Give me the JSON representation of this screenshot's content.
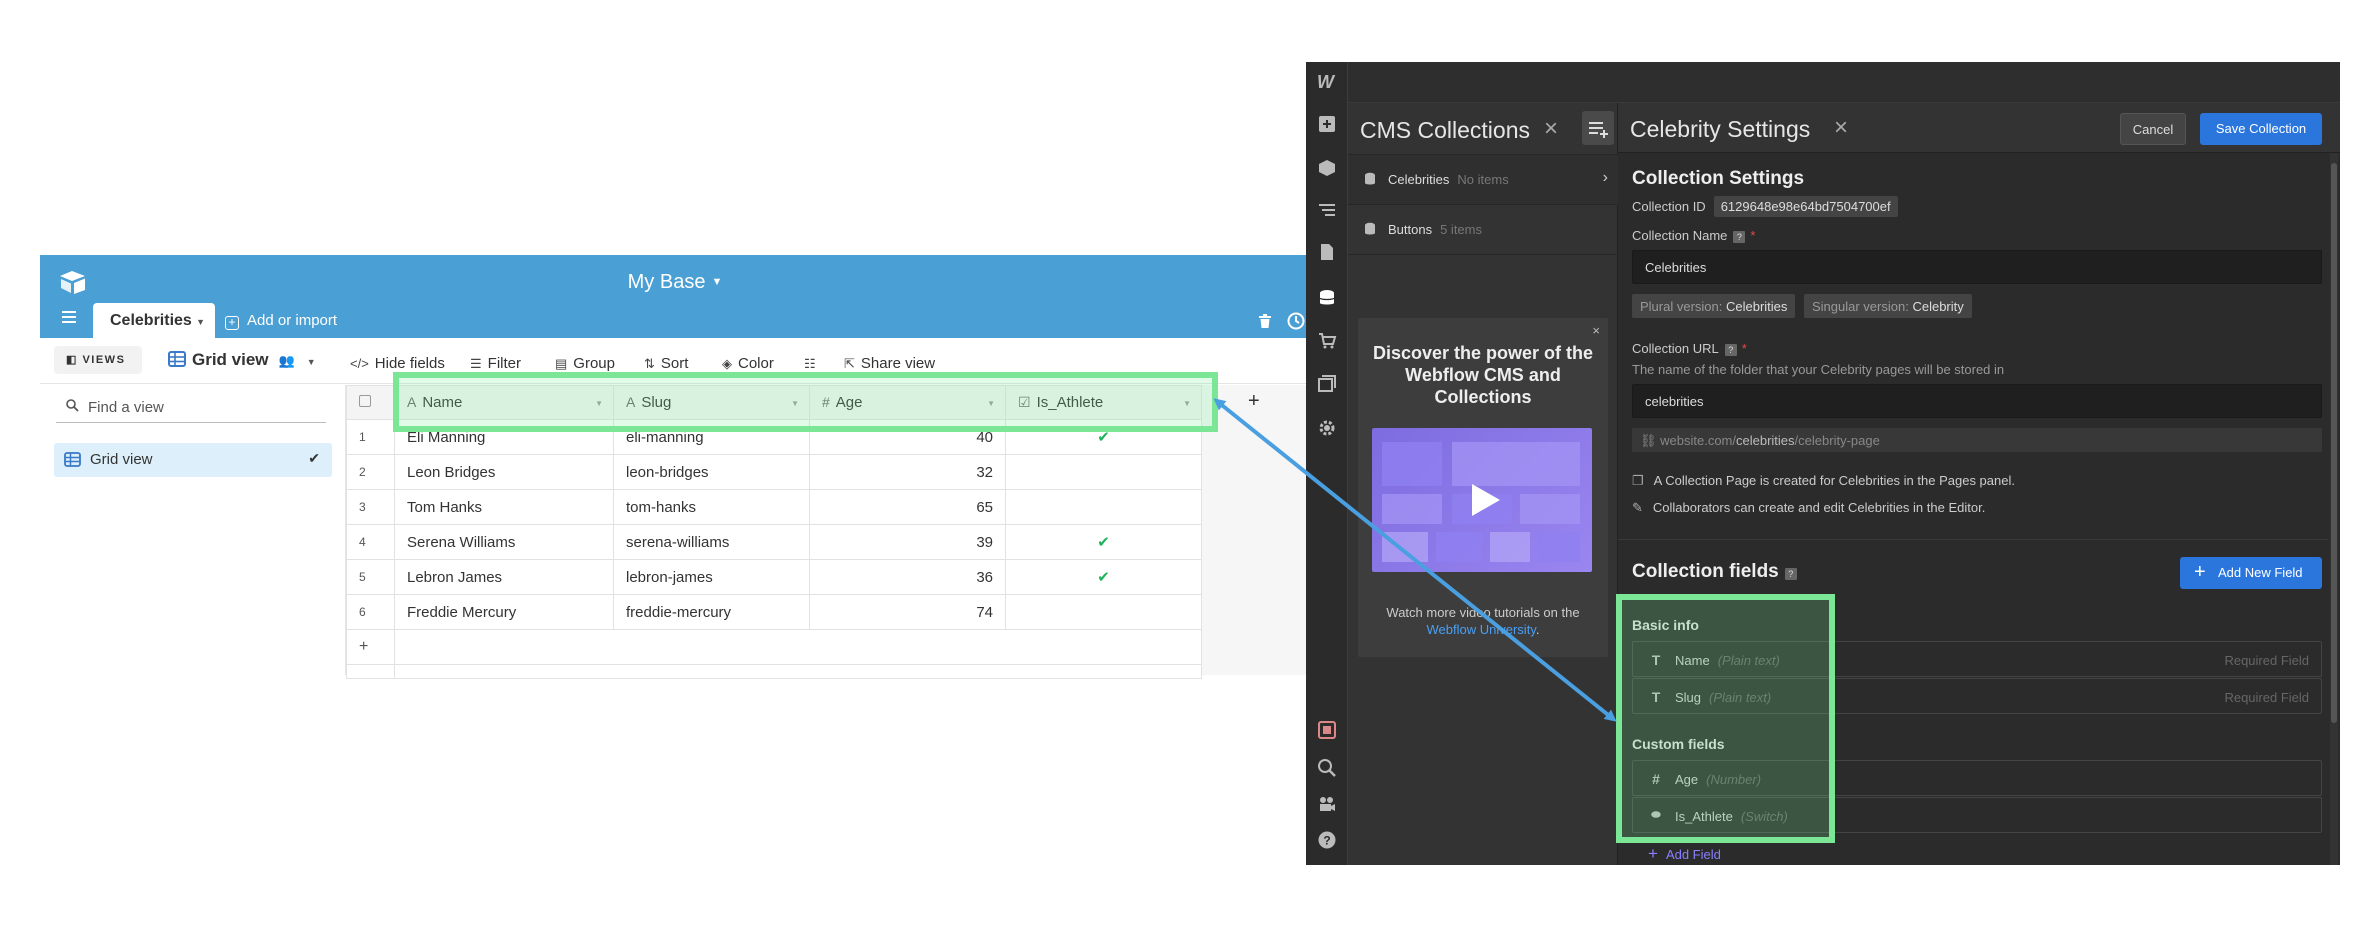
{
  "airtable": {
    "base_title": "My Base",
    "table_tab": "Celebrities",
    "add_import": "Add or import",
    "views_label": "VIEWS",
    "grid_view": "Grid view",
    "toolbar": {
      "hide_fields": "Hide fields",
      "filter": "Filter",
      "group": "Group",
      "sort": "Sort",
      "color": "Color",
      "share_view": "Share view"
    },
    "find_view_placeholder": "Find a view",
    "sidebar_view": "Grid view",
    "columns": [
      "Name",
      "Slug",
      "Age",
      "Is_Athlete"
    ],
    "rows": [
      {
        "n": "1",
        "name": "Eli Manning",
        "slug": "eli-manning",
        "age": "40",
        "athlete": "✔"
      },
      {
        "n": "2",
        "name": "Leon Bridges",
        "slug": "leon-bridges",
        "age": "32",
        "athlete": ""
      },
      {
        "n": "3",
        "name": "Tom Hanks",
        "slug": "tom-hanks",
        "age": "65",
        "athlete": ""
      },
      {
        "n": "4",
        "name": "Serena Williams",
        "slug": "serena-williams",
        "age": "39",
        "athlete": "✔"
      },
      {
        "n": "5",
        "name": "Lebron James",
        "slug": "lebron-james",
        "age": "36",
        "athlete": "✔"
      },
      {
        "n": "6",
        "name": "Freddie Mercury",
        "slug": "freddie-mercury",
        "age": "74",
        "athlete": ""
      }
    ],
    "add_row": "+",
    "add_column": "+"
  },
  "webflow": {
    "cms_title": "CMS Collections",
    "collections": [
      {
        "name": "Celebrities",
        "count": "No items"
      },
      {
        "name": "Buttons",
        "count": "5 items"
      }
    ],
    "promo": {
      "heading": "Discover the power of the Webflow CMS and Collections",
      "close": "×",
      "footer_text": "Watch more video tutorials on the",
      "footer_link": "Webflow University",
      "footer_end": "."
    },
    "settings_title": "Celebrity Settings",
    "cancel": "Cancel",
    "save": "Save Collection",
    "collection_settings_heading": "Collection Settings",
    "collection_id_label": "Collection ID",
    "collection_id": "6129648e98e64bd7504700ef",
    "collection_name_label": "Collection Name",
    "collection_name": "Celebrities",
    "plural_label": "Plural version:",
    "plural_value": "Celebrities",
    "singular_label": "Singular version:",
    "singular_value": "Celebrity",
    "collection_url_label": "Collection URL",
    "collection_url_help": "The name of the folder that your Celebrity pages will be stored in",
    "collection_url": "celebrities",
    "url_preview_pre": "website.com/",
    "url_preview_bold": "celebrities",
    "url_preview_post": "/celebrity-page",
    "info1": "A Collection Page is created for Celebrities in the Pages panel.",
    "info2": "Collaborators can create and edit Celebrities in the Editor.",
    "fields_heading": "Collection fields",
    "add_new_field": "Add New Field",
    "basic_info": "Basic info",
    "custom_fields": "Custom fields",
    "fields": [
      {
        "name": "Name",
        "type": "(Plain text)",
        "req": "Required Field"
      },
      {
        "name": "Slug",
        "type": "(Plain text)",
        "req": "Required Field"
      },
      {
        "name": "Age",
        "type": "(Number)",
        "req": ""
      },
      {
        "name": "Is_Athlete",
        "type": "(Switch)",
        "req": ""
      }
    ],
    "add_field": "Add Field"
  },
  "colors": {
    "airtable_header": "#4a9fd4",
    "highlight": "#7be696",
    "arrow": "#4a9fe0",
    "webflow_blue": "#2a76dd"
  }
}
